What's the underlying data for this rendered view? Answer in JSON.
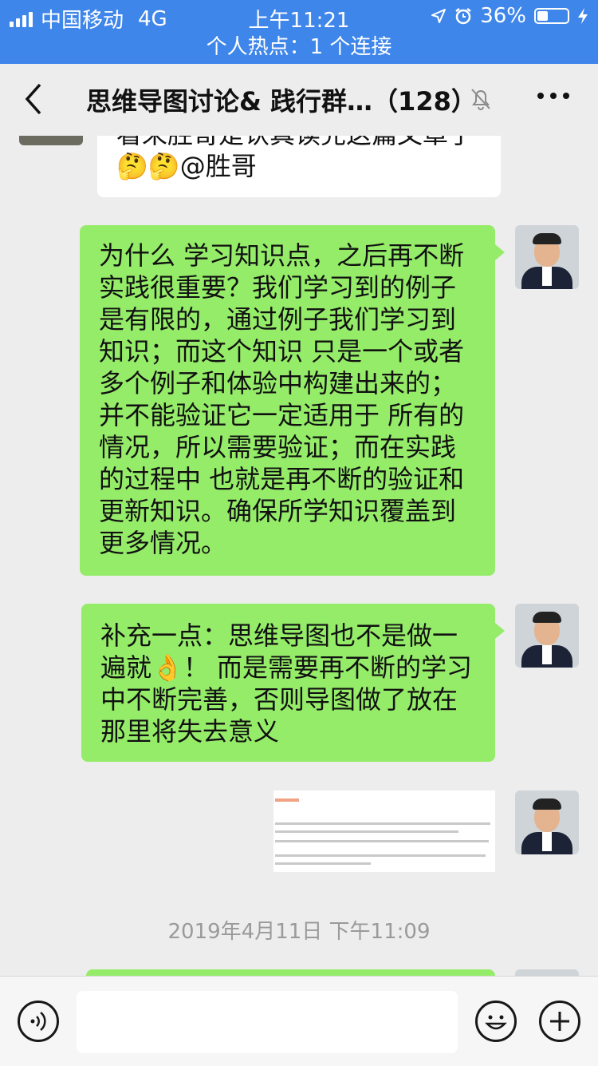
{
  "status_bar": {
    "carrier": "中国移动",
    "network": "4G",
    "time": "上午11:21",
    "battery_percent": "36%",
    "battery_level": 0.36,
    "icons": [
      "signal-icon",
      "location-icon",
      "alarm-icon",
      "battery-icon",
      "charging-icon"
    ]
  },
  "hotspot_banner": "个人热点：1 个连接",
  "header": {
    "title": "思维导图讨论& 践行群…（128）",
    "icons": [
      "back-icon",
      "mute-bell-icon",
      "more-icon"
    ]
  },
  "messages": [
    {
      "side": "left",
      "lines": [
        "看来胜哥是认真读完这篇文章了",
        "🤔🤔@胜哥"
      ]
    },
    {
      "side": "right",
      "lines": [
        "为什么 学习知识点，之后再不断",
        "实践很重要？我们学习到的例子",
        "是有限的，通过例子我们学习到",
        "知识；而这个知识 只是一个或者",
        "多个例子和体验中构建出来的；",
        "并不能验证它一定适用于 所有的",
        "情况，所以需要验证；而在实践",
        "的过程中 也就是再不断的验证和",
        "更新知识。确保所学知识覆盖到",
        "更多情况。"
      ]
    },
    {
      "side": "right",
      "lines": [
        "补充一点：思维导图也不是做一",
        "遍就👌！ 而是需要再不断的学习",
        "中不断完善，否则导图做了放在",
        "那里将失去意义"
      ]
    },
    {
      "side": "right",
      "type": "image"
    }
  ],
  "timestamp": "2019年4月11日 下午11:09",
  "input_bar": {
    "icons": [
      "voice-icon",
      "emoji-icon",
      "plus-icon"
    ]
  }
}
